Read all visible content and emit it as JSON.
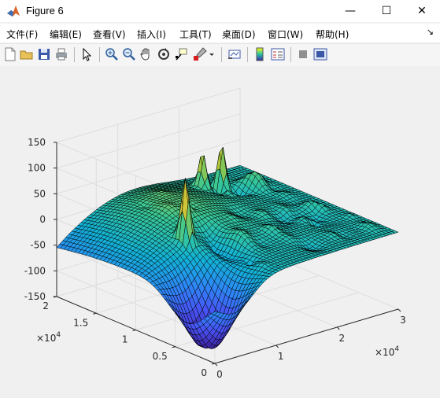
{
  "window": {
    "title": "Figure 6",
    "minimize_glyph": "—",
    "maximize_glyph": "☐",
    "close_glyph": "✕"
  },
  "menu": {
    "items": [
      {
        "label": "文件(F)"
      },
      {
        "label": "编辑(E)"
      },
      {
        "label": "查看(V)"
      },
      {
        "label": "插入(I)"
      },
      {
        "label": "工具(T)"
      },
      {
        "label": "桌面(D)"
      },
      {
        "label": "窗口(W)"
      },
      {
        "label": "帮助(H)"
      }
    ],
    "overflow_glyph": "↘"
  },
  "toolbar": {
    "icons": [
      "new-figure-icon",
      "open-file-icon",
      "save-icon",
      "print-icon",
      "pointer-icon",
      "zoom-in-icon",
      "zoom-out-icon",
      "pan-icon",
      "rotate-3d-icon",
      "data-cursor-icon",
      "brush-icon",
      "brush-dropdown-icon",
      "link-plot-icon",
      "colorbar-icon",
      "legend-icon",
      "hide-plot-tools-icon",
      "show-plot-tools-icon"
    ]
  },
  "chart_data": {
    "type": "surface",
    "title": "",
    "xlabel": "",
    "ylabel": "",
    "zlabel": "",
    "x_ticks": [
      "0",
      "1",
      "2",
      "3"
    ],
    "x_exponent": "×10^4",
    "y_ticks": [
      "0",
      "0.5",
      "1",
      "1.5",
      "2"
    ],
    "y_exponent": "×10^4",
    "z_ticks": [
      "-150",
      "-100",
      "-50",
      "0",
      "50",
      "100",
      "150"
    ],
    "xlim": [
      0,
      30000
    ],
    "ylim": [
      0,
      20000
    ],
    "zlim": [
      -150,
      150
    ],
    "colormap": "parula",
    "grid": true,
    "notable_peaks_z": [
      75,
      55,
      35
    ],
    "notable_trough_z": -140
  },
  "colors": {
    "axes_bg": "#f0f0f0",
    "grid": "#dedede",
    "mesh_line": "#000000"
  }
}
